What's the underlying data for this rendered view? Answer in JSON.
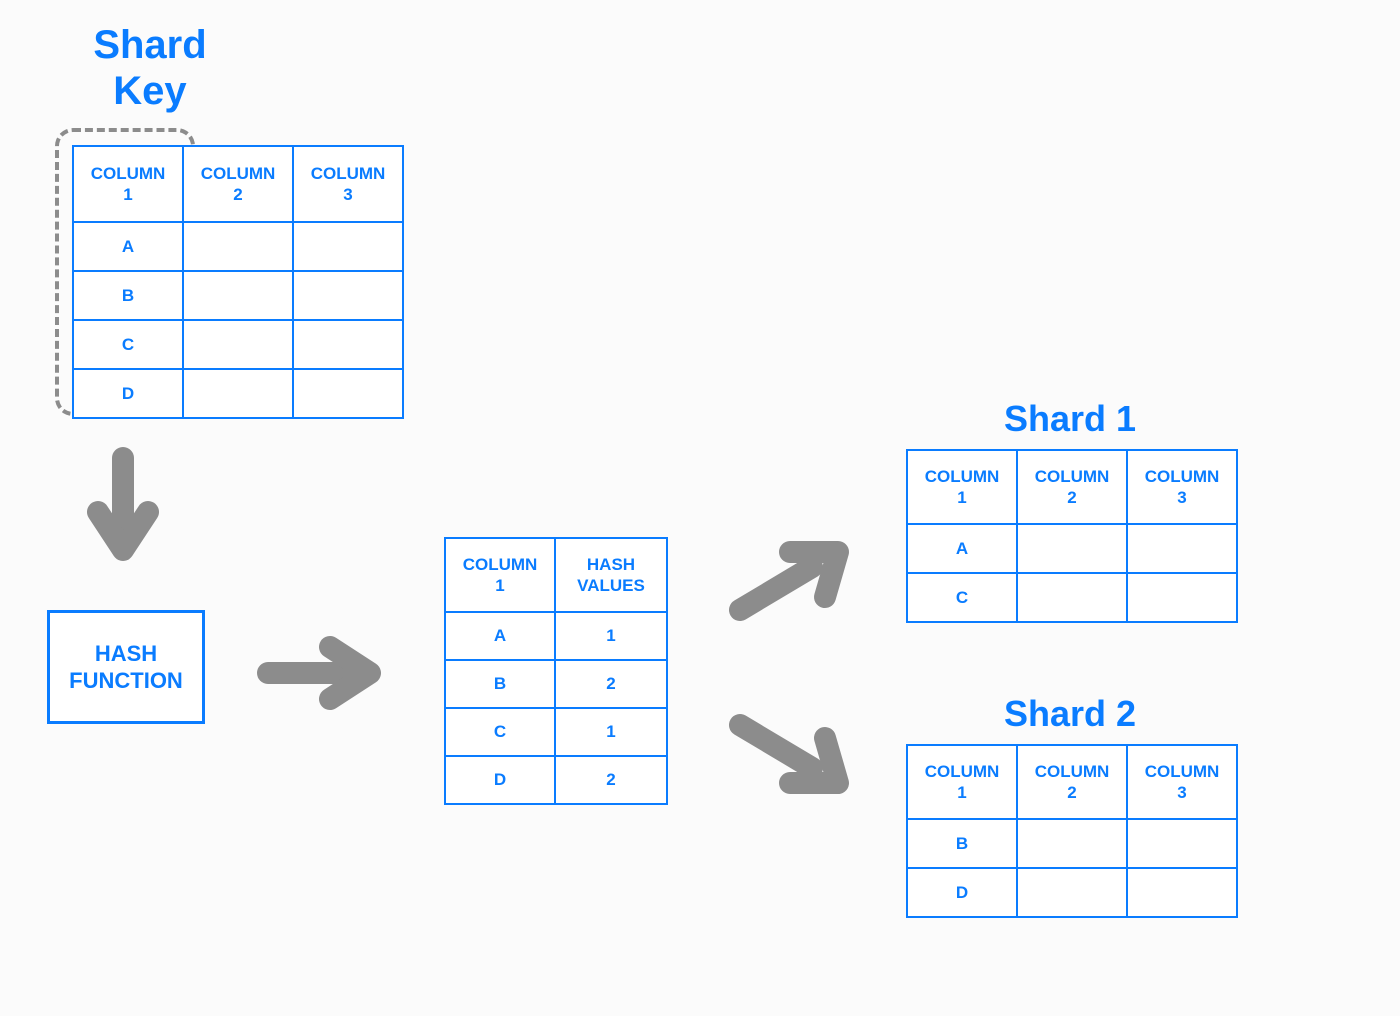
{
  "labels": {
    "shard_key": "Shard\nKey",
    "hash_function": "HASH\nFUNCTION",
    "shard1": "Shard 1",
    "shard2": "Shard 2"
  },
  "source_table": {
    "columns": [
      "COLUMN 1",
      "COLUMN 2",
      "COLUMN 3"
    ],
    "rows": [
      [
        "A",
        "",
        ""
      ],
      [
        "B",
        "",
        ""
      ],
      [
        "C",
        "",
        ""
      ],
      [
        "D",
        "",
        ""
      ]
    ]
  },
  "hash_table": {
    "columns": [
      "COLUMN 1",
      "HASH VALUES"
    ],
    "rows": [
      [
        "A",
        "1"
      ],
      [
        "B",
        "2"
      ],
      [
        "C",
        "1"
      ],
      [
        "D",
        "2"
      ]
    ]
  },
  "shard1_table": {
    "columns": [
      "COLUMN 1",
      "COLUMN 2",
      "COLUMN 3"
    ],
    "rows": [
      [
        "A",
        "",
        ""
      ],
      [
        "C",
        "",
        ""
      ]
    ]
  },
  "shard2_table": {
    "columns": [
      "COLUMN 1",
      "COLUMN 2",
      "COLUMN 3"
    ],
    "rows": [
      [
        "B",
        "",
        ""
      ],
      [
        "D",
        "",
        ""
      ]
    ]
  }
}
